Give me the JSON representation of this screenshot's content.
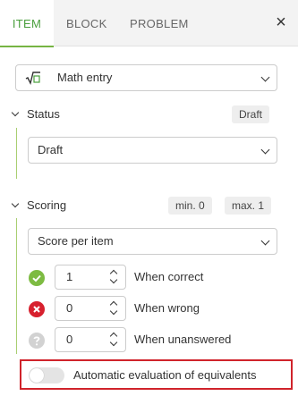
{
  "tabs": [
    {
      "label": "ITEM",
      "active": true
    },
    {
      "label": "BLOCK",
      "active": false
    },
    {
      "label": "PROBLEM",
      "active": false
    }
  ],
  "close_icon": "×",
  "item_type": {
    "label": "Math entry",
    "icon": "square-root-icon"
  },
  "status": {
    "title": "Status",
    "badge": "Draft",
    "select_value": "Draft"
  },
  "scoring": {
    "title": "Scoring",
    "min_label": "min. 0",
    "max_label": "max. 1",
    "mode_value": "Score per item",
    "rows": [
      {
        "value": "1",
        "label": "When correct",
        "icon": "check-circle-icon"
      },
      {
        "value": "0",
        "label": "When wrong",
        "icon": "x-circle-icon"
      },
      {
        "value": "0",
        "label": "When unanswered",
        "icon": "question-circle-icon"
      }
    ],
    "toggle_label": "Automatic evaluation of equivalents",
    "toggle_on": false
  },
  "colors": {
    "accent": "#76b443",
    "error": "#d7202e",
    "highlight_border": "#d0232b"
  }
}
